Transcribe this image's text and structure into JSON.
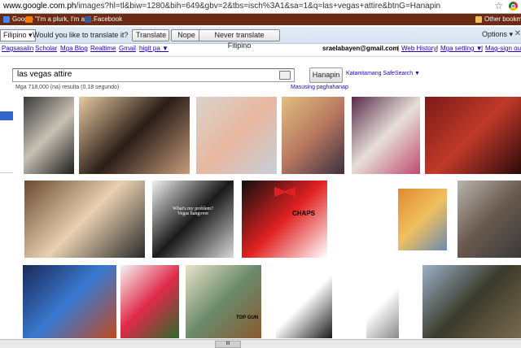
{
  "browser": {
    "url_host": "www.google.com.ph",
    "url_path": "/images?hl=tl&biw=1280&bih=649&gbv=2&tbs=isch%3A1&sa=1&q=las+vegas+attire&btnG=Hanapin",
    "star_glyph": "☆",
    "bookmarks": [
      {
        "label": "Google",
        "color": "#4285f4"
      },
      {
        "label": "\"I'm a plurk, I'm a pl...",
        "color": "#f57c00"
      },
      {
        "label": "Facebook",
        "color": "#3b5998"
      }
    ],
    "other_bookmarks": "Other bookm"
  },
  "translate_bar": {
    "language": "Filipino ▾",
    "question": "Would you like to translate it?",
    "translate_btn": "Translate",
    "nope_btn": "Nope",
    "never_btn": "Never translate Filipino",
    "options": "Options ▾",
    "close": "✕"
  },
  "google_bar": {
    "links": [
      "Pagsasalin",
      "Scholar",
      "Mga Blog",
      "Realtime",
      "Gmail",
      "higit pa ▼"
    ],
    "email": "sraelabayen@gmail.com",
    "right_links": [
      "Web History",
      "Mga setting ▼",
      "Mag-sign out"
    ]
  },
  "search": {
    "query": "las vegas attire",
    "button": "Hanapin",
    "safesearch": "Katamtamang SafeSearch ▼",
    "stats": "Mga 718,000 (na) resulta (0.18 segundo)",
    "advanced": "Masusing paghahanap"
  },
  "results": [
    {
      "name": "result-image-1",
      "colors": [
        "#3a3a3a",
        "#c9c2b4",
        "#1d1d1d"
      ]
    },
    {
      "name": "result-image-2",
      "colors": [
        "#e8c9a0",
        "#2a1e18",
        "#c79b7a"
      ]
    },
    {
      "name": "result-image-3",
      "colors": [
        "#d9d3cc",
        "#e8b8a0",
        "#c7cfd8"
      ]
    },
    {
      "name": "result-image-4",
      "colors": [
        "#e0c080",
        "#b87860",
        "#3c3040"
      ]
    },
    {
      "name": "result-image-5",
      "colors": [
        "#5a2a4a",
        "#e6e0d8",
        "#c04a70"
      ]
    },
    {
      "name": "result-image-6",
      "colors": [
        "#7a1a18",
        "#c03a2a",
        "#2a0a0a"
      ]
    },
    {
      "name": "result-image-7",
      "colors": [
        "#6a4a30",
        "#e8d0b0",
        "#2a2a2a"
      ]
    },
    {
      "name": "result-image-8",
      "colors": [
        "#f2f2f2",
        "#1a1a1a",
        "#d8d8d8"
      ]
    },
    {
      "name": "result-image-9",
      "colors": [
        "#101010",
        "#e02020",
        "#ffffff"
      ]
    },
    {
      "name": "result-image-10",
      "colors": [
        "#ffffff",
        "#ffffff",
        "#ffffff"
      ]
    },
    {
      "name": "result-image-11",
      "colors": [
        "#e08a30",
        "#f0c060",
        "#6a8ab0"
      ]
    },
    {
      "name": "result-image-12",
      "colors": [
        "#b8b4ac",
        "#6a5a50",
        "#3a3a3a"
      ]
    },
    {
      "name": "result-image-13",
      "colors": [
        "#1a2a5a",
        "#3a7ad0",
        "#c04a20"
      ]
    },
    {
      "name": "result-image-14",
      "colors": [
        "#f4f4f4",
        "#e02a4a",
        "#2a6a2a"
      ]
    },
    {
      "name": "result-image-15",
      "colors": [
        "#e8e2c8",
        "#6a8a6a",
        "#8a5a30"
      ]
    },
    {
      "name": "result-image-16",
      "colors": [
        "#ffffff",
        "#ffffff",
        "#1a1a1a"
      ]
    },
    {
      "name": "result-image-17",
      "colors": [
        "#ffffff",
        "#ffffff",
        "#8a8a8a"
      ]
    },
    {
      "name": "result-image-18",
      "colors": [
        "#9ab0c8",
        "#3a3a2a",
        "#7a6a50"
      ]
    }
  ],
  "poster_texts": {
    "shirt": "What's my problem?",
    "shirt2": "Vegas hangover",
    "chaps": "CHAPS",
    "topgun": "TOP GUN"
  },
  "scroll_label": "III"
}
